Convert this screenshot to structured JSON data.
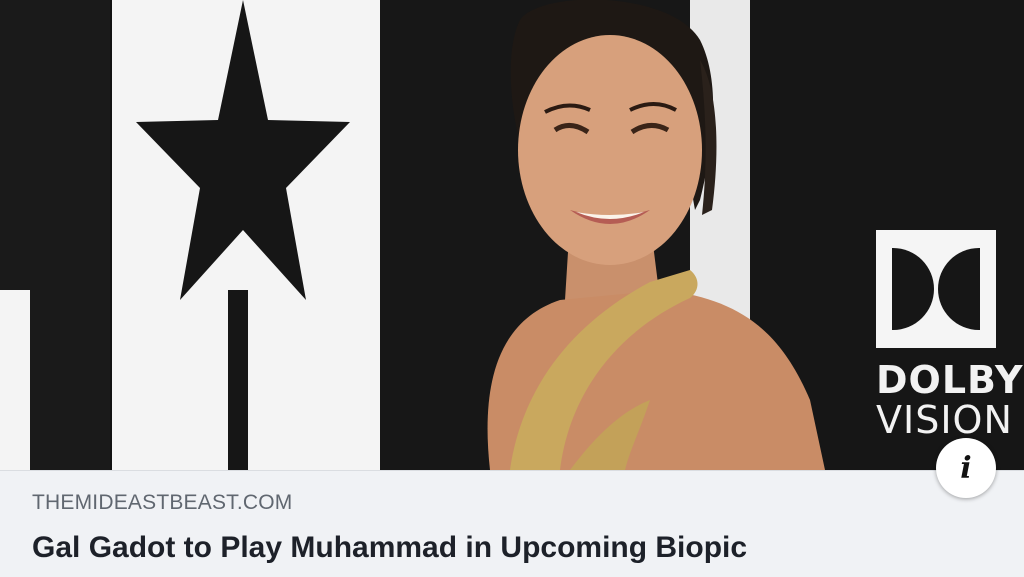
{
  "link_preview": {
    "domain": "THEMIDEASTBEAST.COM",
    "headline": "Gal Gadot to Play Muhammad in Upcoming Biopic",
    "info_icon": "i"
  },
  "photo": {
    "logo_line1": "DOLBY",
    "logo_line2": "VISION"
  },
  "colors": {
    "caption_bg": "#f0f2f5",
    "domain_text": "#606770",
    "headline_text": "#1d2129"
  }
}
